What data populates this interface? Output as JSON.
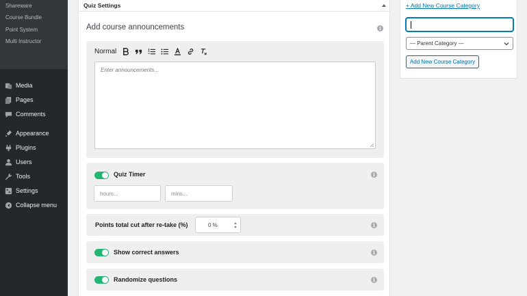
{
  "sidebar": {
    "submenu": [
      "Shareware",
      "Course Bundle",
      "Point System",
      "Multi Instructor"
    ],
    "menu": [
      {
        "label": "Media",
        "icon": "media-icon"
      },
      {
        "label": "Pages",
        "icon": "pages-icon"
      },
      {
        "label": "Comments",
        "icon": "comments-icon"
      },
      {
        "label": "Appearance",
        "icon": "appearance-icon"
      },
      {
        "label": "Plugins",
        "icon": "plugins-icon"
      },
      {
        "label": "Users",
        "icon": "users-icon"
      },
      {
        "label": "Tools",
        "icon": "tools-icon"
      },
      {
        "label": "Settings",
        "icon": "settings-icon"
      },
      {
        "label": "Collapse menu",
        "icon": "collapse-menu-icon"
      }
    ]
  },
  "metabox": {
    "title": "Quiz Settings",
    "announcements": {
      "title": "Add course announcements",
      "format_label": "Normal",
      "placeholder": "Enter announcements..."
    },
    "quiz_timer": {
      "label": "Quiz Timer",
      "enabled": true,
      "hours_placeholder": "hours...",
      "mins_placeholder": "mins..."
    },
    "points": {
      "label": "Points total cut after re-take (%)",
      "value": "0 %"
    },
    "show_correct": {
      "label": "Show correct answers",
      "enabled": true
    },
    "randomize": {
      "label": "Randomize questions",
      "enabled": true
    }
  },
  "category_box": {
    "add_link": "+ Add New Course Category",
    "name_value": "",
    "parent_select": "— Parent Category —",
    "add_button": "Add New Course Category"
  },
  "colors": {
    "toggle_on": "#22b573",
    "link": "#0073aa",
    "sidebar_bg": "#23282d"
  }
}
